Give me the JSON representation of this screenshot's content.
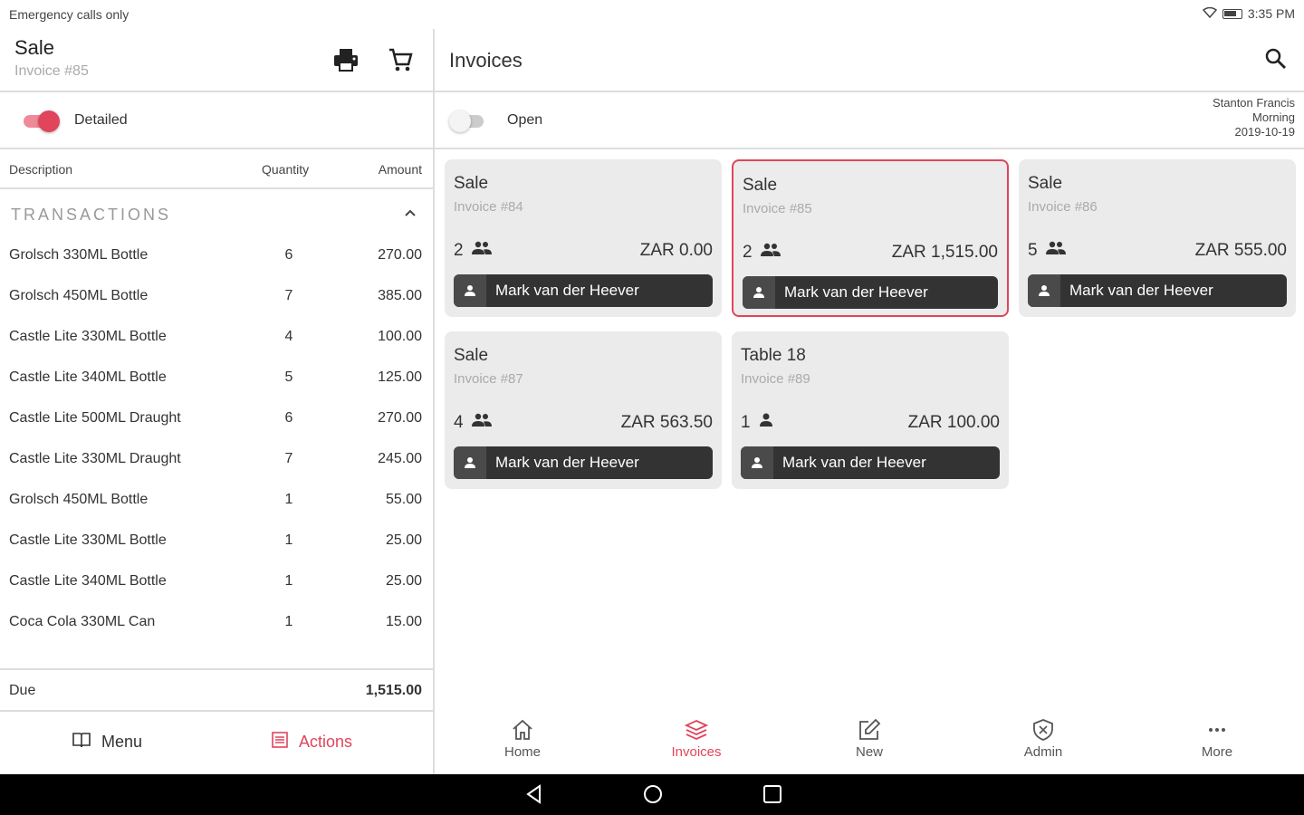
{
  "status": {
    "left": "Emergency calls only",
    "time": "3:35 PM"
  },
  "sale": {
    "title": "Sale",
    "invoice": "Invoice #85"
  },
  "detailed": {
    "label": "Detailed",
    "on": true
  },
  "columns": {
    "description": "Description",
    "quantity": "Quantity",
    "amount": "Amount"
  },
  "section": "TRANSACTIONS",
  "transactions": [
    {
      "description": "Grolsch 330ML Bottle",
      "quantity": "6",
      "amount": "270.00"
    },
    {
      "description": "Grolsch 450ML  Bottle",
      "quantity": "7",
      "amount": "385.00"
    },
    {
      "description": "Castle Lite 330ML Bottle",
      "quantity": "4",
      "amount": "100.00"
    },
    {
      "description": "Castle Lite 340ML Bottle",
      "quantity": "5",
      "amount": "125.00"
    },
    {
      "description": "Castle Lite 500ML Draught",
      "quantity": "6",
      "amount": "270.00"
    },
    {
      "description": "Castle Lite 330ML Draught",
      "quantity": "7",
      "amount": "245.00"
    },
    {
      "description": "Grolsch 450ML  Bottle",
      "quantity": "1",
      "amount": "55.00"
    },
    {
      "description": "Castle Lite 330ML Bottle",
      "quantity": "1",
      "amount": "25.00"
    },
    {
      "description": "Castle Lite 340ML Bottle",
      "quantity": "1",
      "amount": "25.00"
    },
    {
      "description": "Coca Cola 330ML Can",
      "quantity": "1",
      "amount": "15.00"
    }
  ],
  "due": {
    "label": "Due",
    "value": "1,515.00"
  },
  "left_bottom": {
    "menu": "Menu",
    "actions": "Actions"
  },
  "invoices": {
    "title": "Invoices"
  },
  "open": {
    "label": "Open",
    "on": false
  },
  "meta": {
    "name": "Stanton Francis",
    "shift": "Morning",
    "date": "2019-10-19"
  },
  "cards": [
    {
      "title": "Sale",
      "invoice": "Invoice #84",
      "guests": "2",
      "amount": "ZAR 0.00",
      "user": "Mark van der Heever",
      "selected": false,
      "single": false
    },
    {
      "title": "Sale",
      "invoice": "Invoice #85",
      "guests": "2",
      "amount": "ZAR 1,515.00",
      "user": "Mark van der Heever",
      "selected": true,
      "single": false
    },
    {
      "title": "Sale",
      "invoice": "Invoice #86",
      "guests": "5",
      "amount": "ZAR 555.00",
      "user": "Mark van der Heever",
      "selected": false,
      "single": false
    },
    {
      "title": "Sale",
      "invoice": "Invoice #87",
      "guests": "4",
      "amount": "ZAR 563.50",
      "user": "Mark van der Heever",
      "selected": false,
      "single": false
    },
    {
      "title": "Table 18",
      "invoice": "Invoice #89",
      "guests": "1",
      "amount": "ZAR 100.00",
      "user": "Mark van der Heever",
      "selected": false,
      "single": true
    }
  ],
  "nav": [
    {
      "label": "Home",
      "icon": "home-icon",
      "active": false
    },
    {
      "label": "Invoices",
      "icon": "layers-icon",
      "active": true
    },
    {
      "label": "New",
      "icon": "edit-icon",
      "active": false
    },
    {
      "label": "Admin",
      "icon": "shield-icon",
      "active": false
    },
    {
      "label": "More",
      "icon": "more-icon",
      "active": false
    }
  ],
  "colors": {
    "accent": "#e0455b",
    "toggle_on_track": "#f08a98",
    "dark": "#333333"
  }
}
